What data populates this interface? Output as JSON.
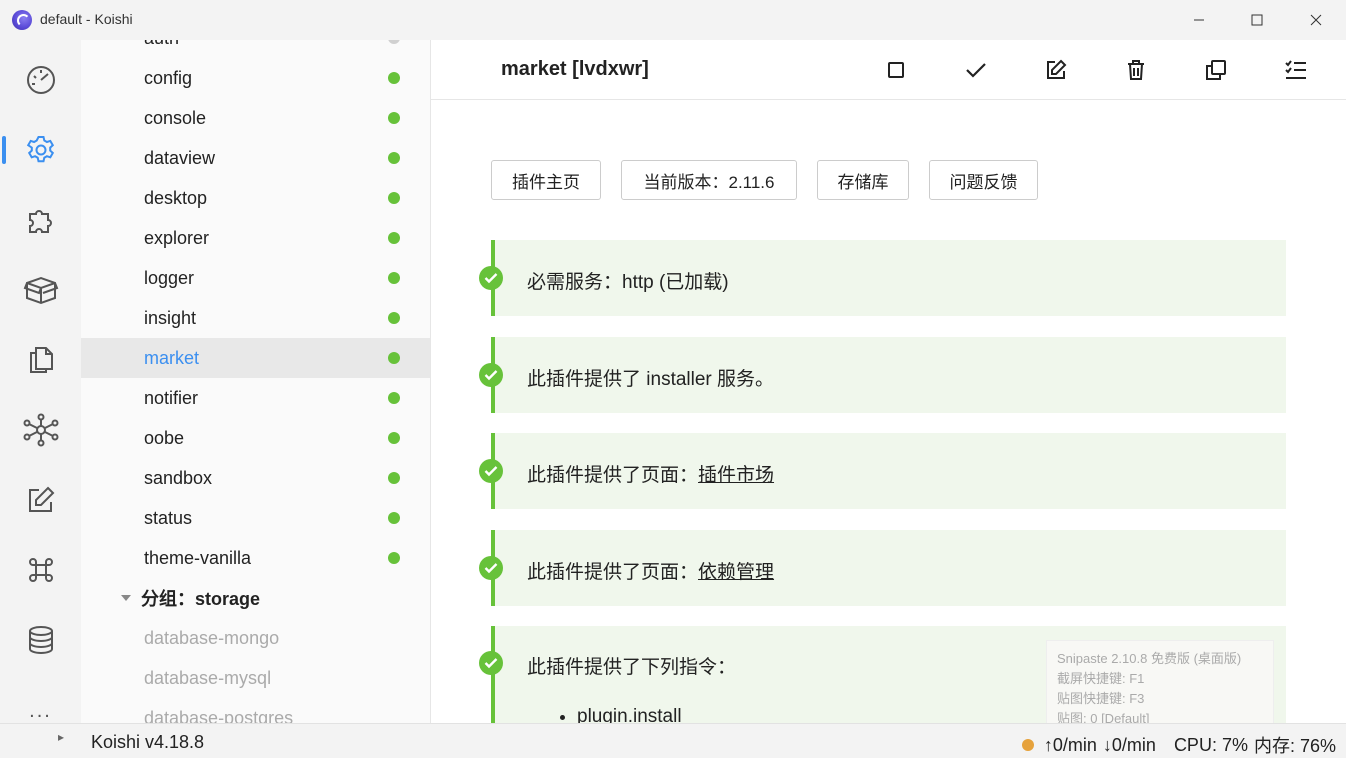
{
  "window": {
    "title": "default - Koishi",
    "minimize": "minimize",
    "maximize": "maximize",
    "close": "close"
  },
  "activity_bar": {
    "items": [
      {
        "name": "dashboard",
        "icon": "gauge-icon"
      },
      {
        "name": "settings",
        "icon": "gear-icon",
        "active": true
      },
      {
        "name": "market",
        "icon": "puzzle-icon"
      },
      {
        "name": "dependencies",
        "icon": "package-icon"
      },
      {
        "name": "files",
        "icon": "files-icon"
      },
      {
        "name": "graph",
        "icon": "network-icon"
      },
      {
        "name": "sandbox",
        "icon": "edit-icon"
      },
      {
        "name": "commands",
        "icon": "command-icon"
      },
      {
        "name": "database",
        "icon": "database-icon"
      }
    ],
    "more": "..."
  },
  "sidebar": {
    "partial_top": "auth",
    "items": [
      {
        "label": "config",
        "status": "active"
      },
      {
        "label": "console",
        "status": "active"
      },
      {
        "label": "dataview",
        "status": "active"
      },
      {
        "label": "desktop",
        "status": "active"
      },
      {
        "label": "explorer",
        "status": "active"
      },
      {
        "label": "logger",
        "status": "active"
      },
      {
        "label": "insight",
        "status": "active"
      },
      {
        "label": "market",
        "status": "active",
        "selected": true
      },
      {
        "label": "notifier",
        "status": "active"
      },
      {
        "label": "oobe",
        "status": "active"
      },
      {
        "label": "sandbox",
        "status": "active"
      },
      {
        "label": "status",
        "status": "active"
      },
      {
        "label": "theme-vanilla",
        "status": "active"
      }
    ],
    "group_header": "分组：storage",
    "group_items": [
      {
        "label": "database-mongo"
      },
      {
        "label": "database-mysql"
      },
      {
        "label": "database-postgres"
      }
    ],
    "expand_arrow": "▸"
  },
  "main": {
    "title": "market [lvdxwr]",
    "toolbar": [
      "stop-icon",
      "check-icon",
      "edit-icon",
      "trash-icon",
      "copy-icon",
      "checklist-icon"
    ],
    "links": [
      {
        "label": "插件主页"
      },
      {
        "label": "当前版本：2.11.6"
      },
      {
        "label": "存储库"
      },
      {
        "label": "问题反馈"
      }
    ],
    "cards": [
      {
        "text": "必需服务：http (已加载)"
      },
      {
        "text": "此插件提供了 installer 服务。"
      },
      {
        "prefix": "此插件提供了页面：",
        "link": "插件市场"
      },
      {
        "prefix": "此插件提供了页面：",
        "link": "依赖管理"
      },
      {
        "text": "此插件提供了下列指令：",
        "commands": [
          "plugin.install"
        ]
      }
    ]
  },
  "snipaste": {
    "line1": "Snipaste 2.10.8 免费版 (桌面版)",
    "line2": "截屏快捷键: F1",
    "line3": "贴图快捷键: F3",
    "line4": "贴图: 0 [Default]"
  },
  "statusbar": {
    "version": "Koishi v4.18.8",
    "upload": "↑0/min",
    "download": "↓0/min",
    "cpu": "CPU: 7%",
    "memory": "内存: 76%"
  },
  "colors": {
    "accent": "#3b8ff0",
    "success": "#67c23a",
    "warning": "#e6a23c",
    "card_bg": "#f0f7ec"
  }
}
